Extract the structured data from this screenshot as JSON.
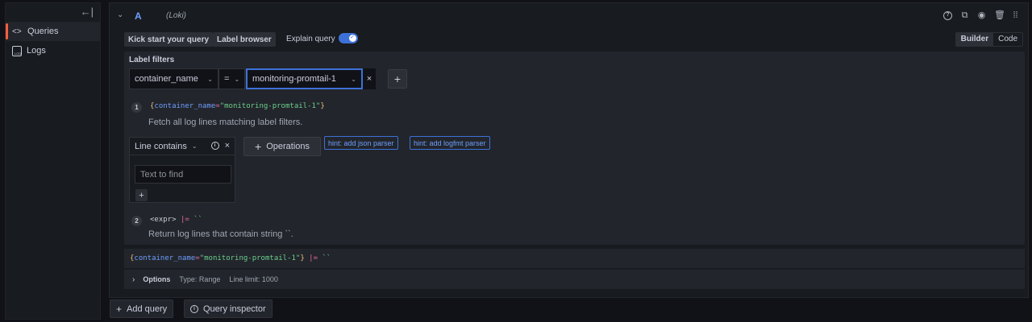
{
  "sidebar": {
    "collapse_icon": "←|",
    "items": [
      {
        "label": "Queries",
        "icon": "code-icon",
        "icon_glyph": "<>",
        "active": true
      },
      {
        "label": "Logs",
        "icon": "logs-icon",
        "active": false
      }
    ]
  },
  "query_row": {
    "ref_id": "A",
    "datasource": "(Loki)",
    "header_icons": [
      "help-icon",
      "duplicate-icon",
      "eye-icon",
      "trash-icon",
      "drag-handle-icon"
    ]
  },
  "toolbar": {
    "kick_start_label": "Kick start your query",
    "label_browser_label": "Label browser",
    "explain_query_label": "Explain query",
    "explain_enabled": true,
    "modes": [
      "Builder",
      "Code"
    ],
    "active_mode": "Builder"
  },
  "label_filters": {
    "title": "Label filters",
    "label": "container_name",
    "operator": "=",
    "value": "monitoring-promtail-1",
    "remove_glyph": "×",
    "add_glyph": "+"
  },
  "steps": [
    {
      "num": "1",
      "code": {
        "open": "{",
        "key": "container_name",
        "eq": "=",
        "str": "\"monitoring-promtail-1\"",
        "close": "}"
      },
      "desc": "Fetch all log lines matching label filters."
    },
    {
      "num": "2",
      "code": {
        "expr": "<expr>",
        "op": "|=",
        "str": "``"
      },
      "desc": "Return log lines that contain string ``."
    }
  ],
  "operation": {
    "title": "Line contains",
    "placeholder": "Text to find",
    "value": "",
    "add_glyph": "+"
  },
  "operations_button": "Operations",
  "hints": [
    "hint: add json parser",
    "hint: add logfmt parser"
  ],
  "raw_query": {
    "open": "{",
    "key": "container_name",
    "eq": "=",
    "str": "\"monitoring-promtail-1\"",
    "close": "}",
    "op": "|=",
    "tail": "``"
  },
  "options": {
    "title": "Options",
    "type": "Type: Range",
    "limit": "Line limit: 1000"
  },
  "bottom": {
    "add_query": "Add query",
    "query_inspector": "Query inspector"
  },
  "colors": {
    "accent": "#3d71d9",
    "active_indicator": "#f55f3e",
    "string": "#6ccf8e",
    "key": "#6e9fff"
  }
}
